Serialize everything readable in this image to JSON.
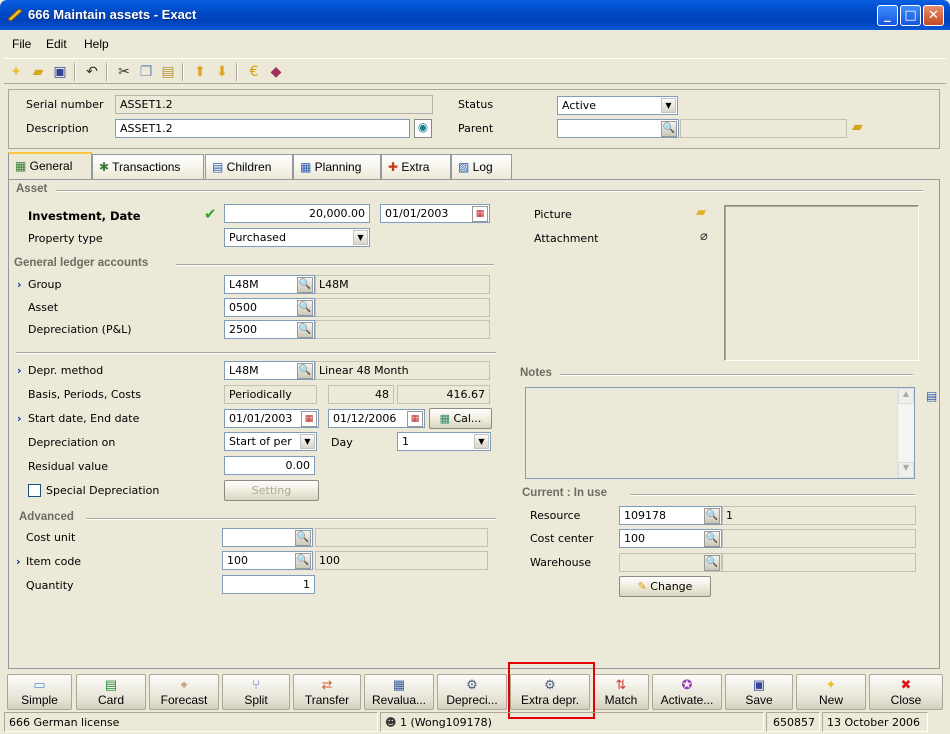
{
  "window": {
    "title": "666 Maintain assets - Exact"
  },
  "menu": [
    "File",
    "Edit",
    "Help"
  ],
  "header": {
    "serial_label": "Serial number",
    "serial_value": "ASSET1.2",
    "description_label": "Description",
    "description_value": "ASSET1.2",
    "status_label": "Status",
    "status_value": "Active",
    "parent_label": "Parent",
    "parent_value": ""
  },
  "tabs": [
    "General",
    "Transactions",
    "Children",
    "Planning",
    "Extra",
    "Log"
  ],
  "asset": {
    "section": "Asset",
    "investment_label": "Investment, Date",
    "investment_value": "20,000.00",
    "investment_date": "01/01/2003",
    "property_label": "Property type",
    "property_value": "Purchased"
  },
  "gl": {
    "section": "General ledger accounts",
    "group_label": "Group",
    "group_code": "L48M",
    "group_desc": "L48M",
    "asset_label": "Asset",
    "asset_code": "0500",
    "asset_desc": "",
    "depr_label": "Depreciation (P&L)",
    "depr_code": "2500",
    "depr_desc": ""
  },
  "depreciation": {
    "method_label": "Depr. method",
    "method_code": "L48M",
    "method_desc": "Linear 48 Month",
    "basis_label": "Basis, Periods, Costs",
    "basis_value": "Periodically",
    "periods_value": "48",
    "costs_value": "416.67",
    "dates_label": "Start date, End date",
    "start_date": "01/01/2003",
    "end_date": "01/12/2006",
    "cal_button": "Cal...",
    "on_label": "Depreciation on",
    "on_value": "Start of per",
    "day_label": "Day",
    "day_value": "1",
    "residual_label": "Residual value",
    "residual_value": "0.00",
    "special_label": "Special Depreciation",
    "setting_button": "Setting"
  },
  "advanced": {
    "section": "Advanced",
    "cost_unit_label": "Cost unit",
    "cost_unit_value": "",
    "item_label": "Item code",
    "item_code": "100",
    "item_desc": "100",
    "quantity_label": "Quantity",
    "quantity_value": "1"
  },
  "right": {
    "picture_label": "Picture",
    "attachment_label": "Attachment",
    "notes_section": "Notes",
    "current_section": "Current : In use",
    "resource_label": "Resource",
    "resource_code": "109178",
    "resource_desc": "1",
    "costcenter_label": "Cost center",
    "costcenter_code": "100",
    "costcenter_desc": "",
    "warehouse_label": "Warehouse",
    "warehouse_code": "",
    "warehouse_desc": "",
    "change_button": "Change"
  },
  "buttons": [
    "Simple",
    "Card",
    "Forecast",
    "Split",
    "Transfer",
    "Revalua...",
    "Depreci...",
    "Extra depr.",
    "Match",
    "Activate...",
    "Save",
    "New",
    "Close"
  ],
  "statusbar": {
    "license": "666 German license",
    "user": "1 (Wong109178)",
    "number": "650857",
    "date": "13 October 2006"
  },
  "colors": {
    "titlebar": "#0049c7",
    "highlight": "#e60000",
    "check": "#2ea82e"
  }
}
